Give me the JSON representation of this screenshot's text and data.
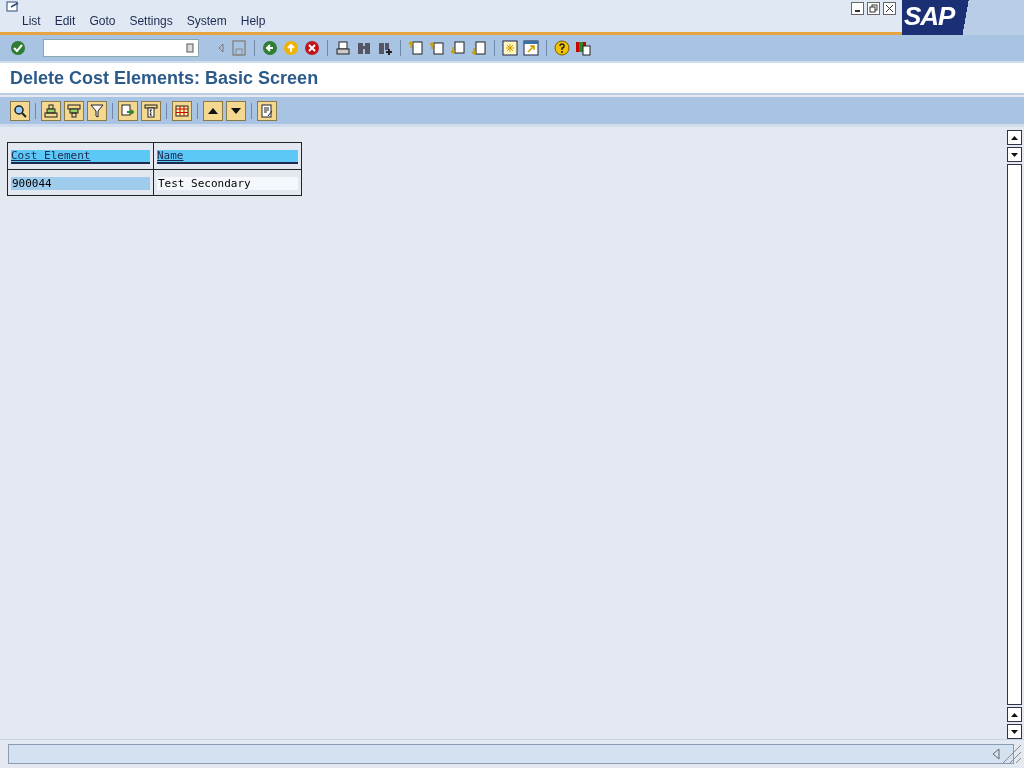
{
  "menu": [
    "List",
    "Edit",
    "Goto",
    "Settings",
    "System",
    "Help"
  ],
  "logo": "SAP",
  "title": "Delete Cost Elements: Basic Screen",
  "table": {
    "columns": [
      "Cost Element",
      "Name"
    ],
    "rows": [
      {
        "cells": [
          "900044",
          "Test Secondary"
        ],
        "selected": true
      }
    ]
  }
}
